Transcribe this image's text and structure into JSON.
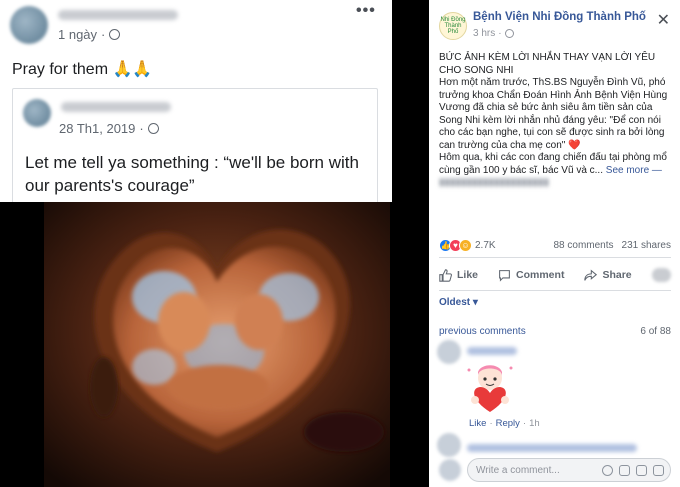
{
  "left_post": {
    "time": "1 ngày",
    "menu": "•••",
    "caption": "Pray for them 🙏🙏",
    "quoted": {
      "time": "28 Th1, 2019",
      "text": "Let me tell ya something : “we'll be born with our parents's courage”"
    }
  },
  "right_post": {
    "page_name": "Bệnh Viện Nhi Đồng Thành Phố",
    "page_avatar_text": "Nhi Đồng Thành Phố",
    "time": "3 hrs",
    "close": "✕",
    "headline": "BỨC ẢNH KÈM LỜI NHẮN THAY VẠN LỜI YÊU CHO SONG NHI",
    "paragraph1": "Hơn một năm trước, ThS.BS Nguyễn Đình Vũ, phó trưởng khoa Chẩn Đoán Hình Ảnh Bệnh Viện Hùng Vương đã chia sẻ bức ảnh siêu âm tiền sản của Song Nhi kèm lời nhắn nhủ đáng yêu: \"Để con nói cho các bạn nghe, tụi con sẽ được sinh ra bởi lòng can trường của cha mẹ con\" ❤️",
    "paragraph2": "Hôm qua, khi các con đang chiến đấu tại phòng mổ cùng gần 100 y bác sĩ, bác Vũ và c...",
    "see_more": "See more —",
    "reaction_count": "2.7K",
    "comments_count": "88 comments",
    "shares_count": "231 shares",
    "actions": {
      "like": "Like",
      "comment": "Comment",
      "share": "Share"
    },
    "sort": "Oldest ▾",
    "previous_comments": "previous comments",
    "comment_position": "6 of 88",
    "comment_like": "Like",
    "comment_reply": "Reply",
    "comment_time": "1h",
    "write_placeholder": "Write a comment...",
    "colors": {
      "link": "#385898",
      "like_blue": "#1877f2",
      "love_red": "#f33e58"
    }
  }
}
